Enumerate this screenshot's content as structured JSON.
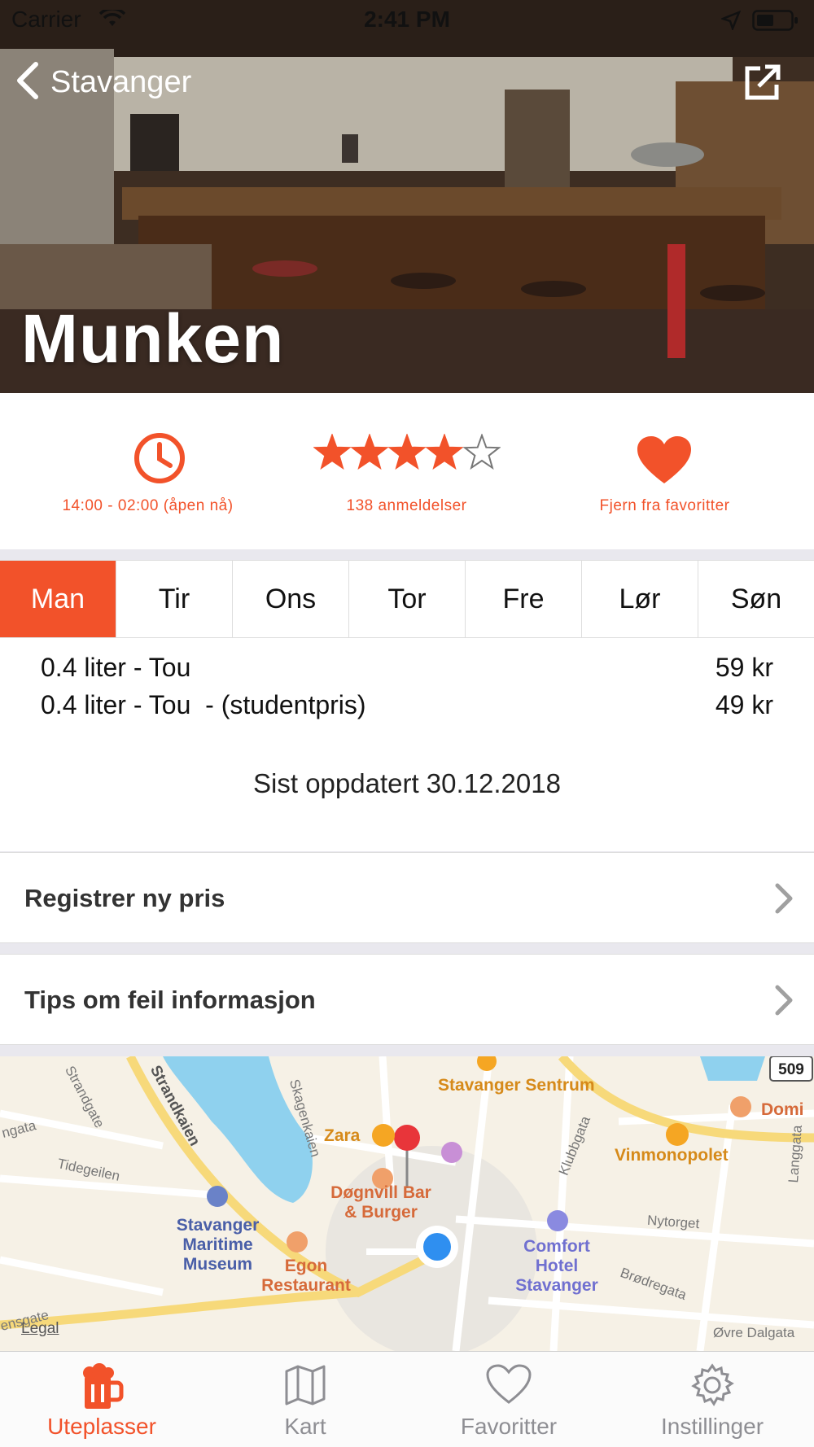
{
  "status_bar": {
    "carrier": "Carrier",
    "time": "2:41 PM"
  },
  "nav": {
    "back_label": "Stavanger",
    "share_icon": "share-external-icon"
  },
  "venue": {
    "name": "Munken"
  },
  "info": {
    "hours": "14:00 - 02:00 (åpen nå)",
    "rating": 4,
    "rating_max": 5,
    "reviews": "138 anmeldelser",
    "favorite": "Fjern fra favoritter"
  },
  "days": [
    {
      "label": "Man",
      "active": true
    },
    {
      "label": "Tir",
      "active": false
    },
    {
      "label": "Ons",
      "active": false
    },
    {
      "label": "Tor",
      "active": false
    },
    {
      "label": "Fre",
      "active": false
    },
    {
      "label": "Lør",
      "active": false
    },
    {
      "label": "Søn",
      "active": false
    }
  ],
  "prices": [
    {
      "name": "0.4 liter - Tou",
      "price": "59 kr"
    },
    {
      "name": "0.4 liter - Tou  - (studentpris)",
      "price": "49 kr"
    }
  ],
  "updated": "Sist oppdatert 30.12.2018",
  "actions": {
    "register_price": "Registrer ny pris",
    "report_error": "Tips om feil informasjon"
  },
  "map": {
    "legal": "Legal",
    "road_number": "509",
    "places": {
      "stavanger_sentrum": "Stavanger Sentrum",
      "zara": "Zara",
      "dognvill": "Døgnvill Bar & Burger",
      "vinmonopolet": "Vinmonopolet",
      "domino": "Domi",
      "museum": "Stavanger Maritime Museum",
      "egon": "Egon Restaurant",
      "comfort": "Comfort Hotel Stavanger"
    },
    "streets": {
      "strandgate": "Strandgate",
      "strandkaien": "Strandkaien",
      "skagenkaien": "Skagenkaien",
      "tidegeilen": "Tidegeilen",
      "klubbgata": "Klubbgata",
      "langgata": "Langgata",
      "nytorget": "Nytorget",
      "brodregata": "Brødregata",
      "ovre_dalgata": "Øvre Dalgata",
      "ngata": "ngata",
      "ensgate": "ensgate"
    }
  },
  "tabs": [
    {
      "label": "Uteplasser",
      "icon": "beer-mug-icon",
      "active": true
    },
    {
      "label": "Kart",
      "icon": "map-icon",
      "active": false
    },
    {
      "label": "Favoritter",
      "icon": "heart-outline-icon",
      "active": false
    },
    {
      "label": "Instillinger",
      "icon": "gear-icon",
      "active": false
    }
  ],
  "colors": {
    "accent": "#f2522a",
    "inactive": "#8e8e93"
  }
}
